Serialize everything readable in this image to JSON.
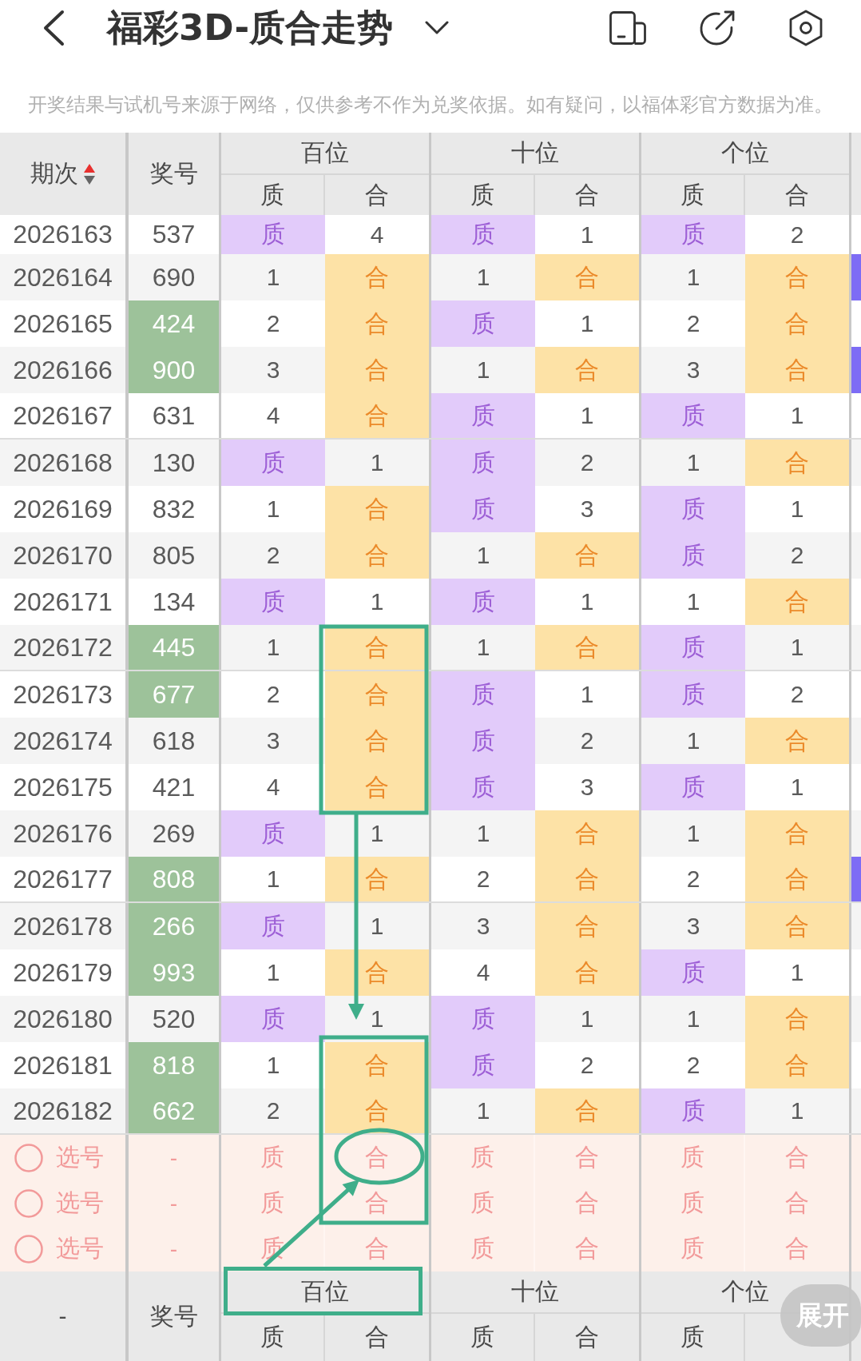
{
  "top_bar": {
    "title": "福彩3D-质合走势"
  },
  "disclaimer": "开奖结果与试机号来源于网络，仅供参考不作为兑奖依据。如有疑问，以福体彩官方数据为准。",
  "table": {
    "header": {
      "period": "期次",
      "sort_ascending": true,
      "number": "奖号",
      "groups": [
        {
          "label": "百位",
          "subcolumns": [
            {
              "label": "质",
              "kind": "prime"
            },
            {
              "label": "合",
              "kind": "composite"
            }
          ]
        },
        {
          "label": "十位",
          "subcolumns": [
            {
              "label": "质",
              "kind": "prime"
            },
            {
              "label": "合",
              "kind": "composite"
            }
          ]
        },
        {
          "label": "个位",
          "subcolumns": [
            {
              "label": "质",
              "kind": "prime"
            },
            {
              "label": "合",
              "kind": "composite"
            }
          ]
        }
      ]
    },
    "rows": [
      {
        "period": "2026163",
        "number": "537",
        "highlighted": false,
        "next_column_marked": false,
        "cells": [
          {
            "text": "质",
            "hit": true
          },
          {
            "text": "4",
            "hit": false
          },
          {
            "text": "质",
            "hit": true
          },
          {
            "text": "1",
            "hit": false
          },
          {
            "text": "质",
            "hit": true
          },
          {
            "text": "2",
            "hit": false
          }
        ]
      },
      {
        "period": "2026164",
        "number": "690",
        "highlighted": false,
        "next_column_marked": true,
        "cells": [
          {
            "text": "1",
            "hit": false
          },
          {
            "text": "合",
            "hit": true
          },
          {
            "text": "1",
            "hit": false
          },
          {
            "text": "合",
            "hit": true
          },
          {
            "text": "1",
            "hit": false
          },
          {
            "text": "合",
            "hit": true
          }
        ]
      },
      {
        "period": "2026165",
        "number": "424",
        "highlighted": true,
        "next_column_marked": false,
        "cells": [
          {
            "text": "2",
            "hit": false
          },
          {
            "text": "合",
            "hit": true
          },
          {
            "text": "质",
            "hit": true
          },
          {
            "text": "1",
            "hit": false
          },
          {
            "text": "2",
            "hit": false
          },
          {
            "text": "合",
            "hit": true
          }
        ]
      },
      {
        "period": "2026166",
        "number": "900",
        "highlighted": true,
        "next_column_marked": true,
        "cells": [
          {
            "text": "3",
            "hit": false
          },
          {
            "text": "合",
            "hit": true
          },
          {
            "text": "1",
            "hit": false
          },
          {
            "text": "合",
            "hit": true
          },
          {
            "text": "3",
            "hit": false
          },
          {
            "text": "合",
            "hit": true
          }
        ]
      },
      {
        "period": "2026167",
        "number": "631",
        "highlighted": false,
        "next_column_marked": false,
        "cells": [
          {
            "text": "4",
            "hit": false
          },
          {
            "text": "合",
            "hit": true
          },
          {
            "text": "质",
            "hit": true
          },
          {
            "text": "1",
            "hit": false
          },
          {
            "text": "质",
            "hit": true
          },
          {
            "text": "1",
            "hit": false
          }
        ]
      },
      {
        "period": "2026168",
        "number": "130",
        "highlighted": false,
        "next_column_marked": false,
        "cells": [
          {
            "text": "质",
            "hit": true
          },
          {
            "text": "1",
            "hit": false
          },
          {
            "text": "质",
            "hit": true
          },
          {
            "text": "2",
            "hit": false
          },
          {
            "text": "1",
            "hit": false
          },
          {
            "text": "合",
            "hit": true
          }
        ]
      },
      {
        "period": "2026169",
        "number": "832",
        "highlighted": false,
        "next_column_marked": false,
        "cells": [
          {
            "text": "1",
            "hit": false
          },
          {
            "text": "合",
            "hit": true
          },
          {
            "text": "质",
            "hit": true
          },
          {
            "text": "3",
            "hit": false
          },
          {
            "text": "质",
            "hit": true
          },
          {
            "text": "1",
            "hit": false
          }
        ]
      },
      {
        "period": "2026170",
        "number": "805",
        "highlighted": false,
        "next_column_marked": false,
        "cells": [
          {
            "text": "2",
            "hit": false
          },
          {
            "text": "合",
            "hit": true
          },
          {
            "text": "1",
            "hit": false
          },
          {
            "text": "合",
            "hit": true
          },
          {
            "text": "质",
            "hit": true
          },
          {
            "text": "2",
            "hit": false
          }
        ]
      },
      {
        "period": "2026171",
        "number": "134",
        "highlighted": false,
        "next_column_marked": false,
        "cells": [
          {
            "text": "质",
            "hit": true
          },
          {
            "text": "1",
            "hit": false
          },
          {
            "text": "质",
            "hit": true
          },
          {
            "text": "1",
            "hit": false
          },
          {
            "text": "1",
            "hit": false
          },
          {
            "text": "合",
            "hit": true
          }
        ]
      },
      {
        "period": "2026172",
        "number": "445",
        "highlighted": true,
        "next_column_marked": false,
        "cells": [
          {
            "text": "1",
            "hit": false
          },
          {
            "text": "合",
            "hit": true
          },
          {
            "text": "1",
            "hit": false
          },
          {
            "text": "合",
            "hit": true
          },
          {
            "text": "质",
            "hit": true
          },
          {
            "text": "1",
            "hit": false
          }
        ]
      },
      {
        "period": "2026173",
        "number": "677",
        "highlighted": true,
        "next_column_marked": false,
        "cells": [
          {
            "text": "2",
            "hit": false
          },
          {
            "text": "合",
            "hit": true
          },
          {
            "text": "质",
            "hit": true
          },
          {
            "text": "1",
            "hit": false
          },
          {
            "text": "质",
            "hit": true
          },
          {
            "text": "2",
            "hit": false
          }
        ]
      },
      {
        "period": "2026174",
        "number": "618",
        "highlighted": false,
        "next_column_marked": false,
        "cells": [
          {
            "text": "3",
            "hit": false
          },
          {
            "text": "合",
            "hit": true
          },
          {
            "text": "质",
            "hit": true
          },
          {
            "text": "2",
            "hit": false
          },
          {
            "text": "1",
            "hit": false
          },
          {
            "text": "合",
            "hit": true
          }
        ]
      },
      {
        "period": "2026175",
        "number": "421",
        "highlighted": false,
        "next_column_marked": false,
        "cells": [
          {
            "text": "4",
            "hit": false
          },
          {
            "text": "合",
            "hit": true
          },
          {
            "text": "质",
            "hit": true
          },
          {
            "text": "3",
            "hit": false
          },
          {
            "text": "质",
            "hit": true
          },
          {
            "text": "1",
            "hit": false
          }
        ]
      },
      {
        "period": "2026176",
        "number": "269",
        "highlighted": false,
        "next_column_marked": false,
        "cells": [
          {
            "text": "质",
            "hit": true
          },
          {
            "text": "1",
            "hit": false
          },
          {
            "text": "1",
            "hit": false
          },
          {
            "text": "合",
            "hit": true
          },
          {
            "text": "1",
            "hit": false
          },
          {
            "text": "合",
            "hit": true
          }
        ]
      },
      {
        "period": "2026177",
        "number": "808",
        "highlighted": true,
        "next_column_marked": true,
        "cells": [
          {
            "text": "1",
            "hit": false
          },
          {
            "text": "合",
            "hit": true
          },
          {
            "text": "2",
            "hit": false
          },
          {
            "text": "合",
            "hit": true
          },
          {
            "text": "2",
            "hit": false
          },
          {
            "text": "合",
            "hit": true
          }
        ]
      },
      {
        "period": "2026178",
        "number": "266",
        "highlighted": true,
        "next_column_marked": false,
        "cells": [
          {
            "text": "质",
            "hit": true
          },
          {
            "text": "1",
            "hit": false
          },
          {
            "text": "3",
            "hit": false
          },
          {
            "text": "合",
            "hit": true
          },
          {
            "text": "3",
            "hit": false
          },
          {
            "text": "合",
            "hit": true
          }
        ]
      },
      {
        "period": "2026179",
        "number": "993",
        "highlighted": true,
        "next_column_marked": false,
        "cells": [
          {
            "text": "1",
            "hit": false
          },
          {
            "text": "合",
            "hit": true
          },
          {
            "text": "4",
            "hit": false
          },
          {
            "text": "合",
            "hit": true
          },
          {
            "text": "质",
            "hit": true
          },
          {
            "text": "1",
            "hit": false
          }
        ]
      },
      {
        "period": "2026180",
        "number": "520",
        "highlighted": false,
        "next_column_marked": false,
        "cells": [
          {
            "text": "质",
            "hit": true
          },
          {
            "text": "1",
            "hit": false
          },
          {
            "text": "质",
            "hit": true
          },
          {
            "text": "1",
            "hit": false
          },
          {
            "text": "1",
            "hit": false
          },
          {
            "text": "合",
            "hit": true
          }
        ]
      },
      {
        "period": "2026181",
        "number": "818",
        "highlighted": true,
        "next_column_marked": false,
        "cells": [
          {
            "text": "1",
            "hit": false
          },
          {
            "text": "合",
            "hit": true
          },
          {
            "text": "质",
            "hit": true
          },
          {
            "text": "2",
            "hit": false
          },
          {
            "text": "2",
            "hit": false
          },
          {
            "text": "合",
            "hit": true
          }
        ]
      },
      {
        "period": "2026182",
        "number": "662",
        "highlighted": true,
        "next_column_marked": false,
        "cells": [
          {
            "text": "2",
            "hit": false
          },
          {
            "text": "合",
            "hit": true
          },
          {
            "text": "1",
            "hit": false
          },
          {
            "text": "合",
            "hit": true
          },
          {
            "text": "质",
            "hit": true
          },
          {
            "text": "1",
            "hit": false
          }
        ]
      }
    ],
    "pick_rows": [
      {
        "selected": false,
        "label": "选号",
        "number": "-",
        "cells": [
          "质",
          "合",
          "质",
          "合",
          "质",
          "合"
        ]
      },
      {
        "selected": false,
        "label": "选号",
        "number": "-",
        "cells": [
          "质",
          "合",
          "质",
          "合",
          "质",
          "合"
        ]
      },
      {
        "selected": false,
        "label": "选号",
        "number": "-",
        "cells": [
          "质",
          "合",
          "质",
          "合",
          "质",
          "合"
        ]
      }
    ],
    "footer": {
      "period": "-",
      "number": "奖号",
      "groups": [
        {
          "label": "百位",
          "subcolumns": [
            "质",
            "合"
          ]
        },
        {
          "label": "十位",
          "subcolumns": [
            "质",
            "合"
          ]
        },
        {
          "label": "个位",
          "subcolumns": [
            "质"
          ]
        }
      ]
    }
  },
  "annotations": [
    {
      "kind": "box"
    },
    {
      "kind": "arrow"
    },
    {
      "kind": "box"
    },
    {
      "kind": "ellipse"
    },
    {
      "kind": "arrow"
    },
    {
      "kind": "box"
    }
  ],
  "expand_button": "展开"
}
